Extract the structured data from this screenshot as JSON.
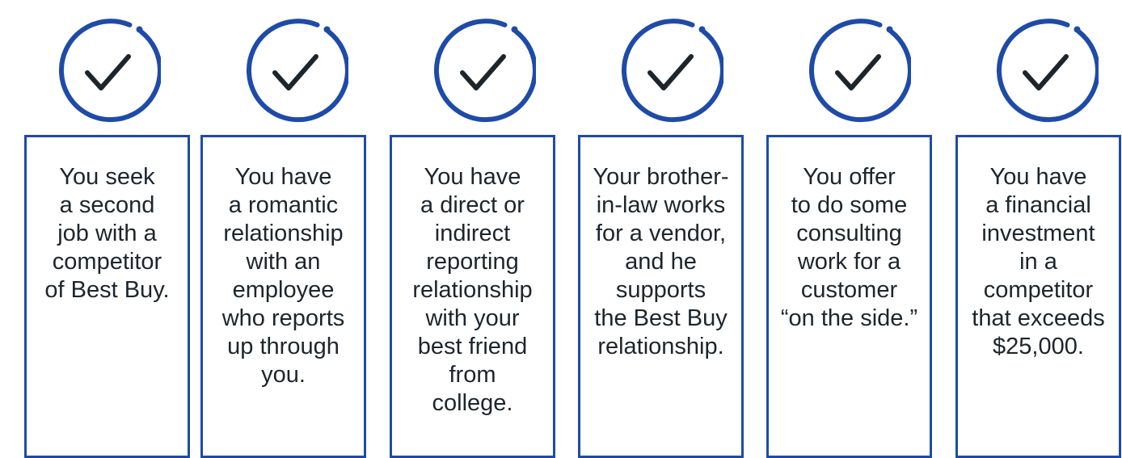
{
  "colors": {
    "accent": "#1e4ba8",
    "check": "#1d252c",
    "text": "#1d252c",
    "background": "#ffffff"
  },
  "icon": "circle-checkmark-icon",
  "cards": [
    {
      "text": "You seek\na second\njob with a\ncompetitor\nof Best Buy."
    },
    {
      "text": "You have\na romantic\nrelationship\nwith an\nemployee\nwho reports\nup through\nyou."
    },
    {
      "text": "You have\na direct or\nindirect\nreporting\nrelationship\nwith your\nbest friend\nfrom\ncollege."
    },
    {
      "text": "Your brother-\nin-law works\nfor a vendor,\nand he\nsupports\nthe Best Buy\nrelationship."
    },
    {
      "text": "You offer\nto do some\nconsulting\nwork for a\ncustomer\n“on the side.”"
    },
    {
      "text": "You have\na financial\ninvestment\nin a\ncompetitor\nthat exceeds\n$25,000."
    }
  ]
}
